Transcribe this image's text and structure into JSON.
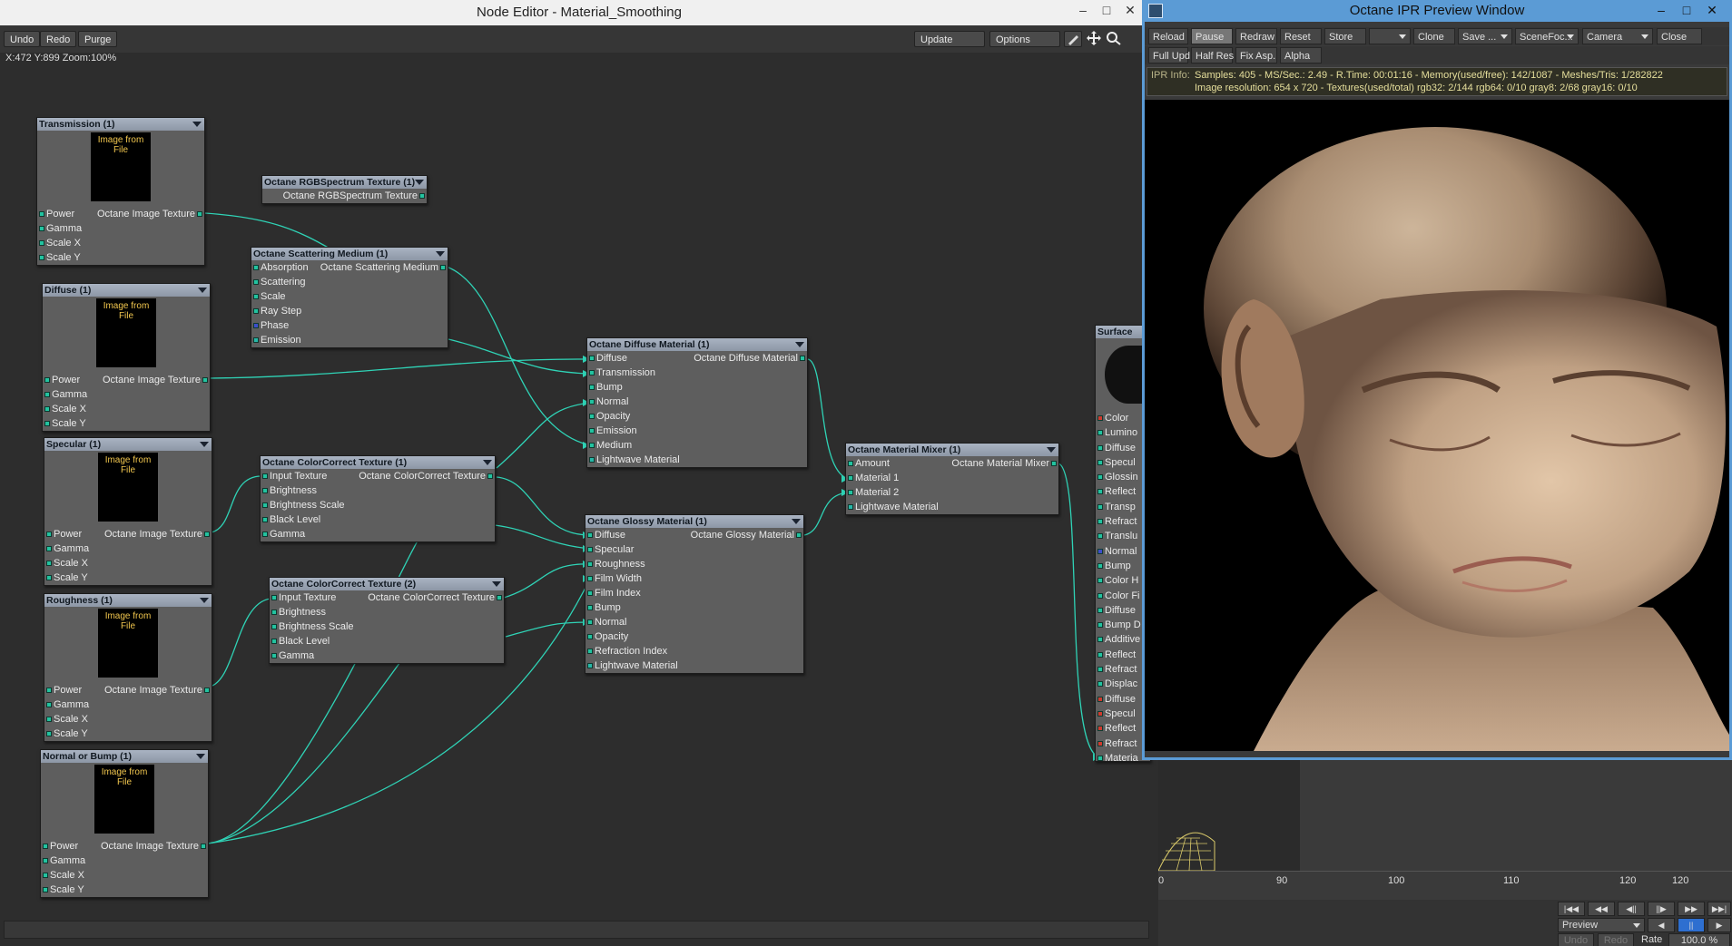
{
  "node_editor": {
    "title": "Node Editor - Material_Smoothing",
    "window_controls": [
      "_",
      "□",
      "✕"
    ],
    "toolbar": {
      "undo": "Undo",
      "redo": "Redo",
      "purge": "Purge",
      "update": "Update",
      "options": "Options"
    },
    "coords": "X:472 Y:899 Zoom:100%"
  },
  "nodes": {
    "transmission": {
      "title": "Transmission (1)",
      "preview": "Image from File",
      "out": "Octane Image Texture",
      "inputs": [
        "Power",
        "Gamma",
        "Scale X",
        "Scale Y"
      ]
    },
    "diffuse": {
      "title": "Diffuse (1)",
      "preview": "Image from File",
      "out": "Octane Image Texture",
      "inputs": [
        "Power",
        "Gamma",
        "Scale X",
        "Scale Y"
      ]
    },
    "specular": {
      "title": "Specular (1)",
      "preview": "Image from File",
      "out": "Octane Image Texture",
      "inputs": [
        "Power",
        "Gamma",
        "Scale X",
        "Scale Y"
      ]
    },
    "roughness": {
      "title": "Roughness (1)",
      "preview": "Image from File",
      "out": "Octane Image Texture",
      "inputs": [
        "Power",
        "Gamma",
        "Scale X",
        "Scale Y"
      ]
    },
    "normal_bump": {
      "title": "Normal or Bump (1)",
      "preview": "Image from File",
      "out": "Octane Image Texture",
      "inputs": [
        "Power",
        "Gamma",
        "Scale X",
        "Scale Y"
      ]
    },
    "rgb_spectrum": {
      "title": "Octane RGBSpectrum Texture (1)",
      "out": "Octane RGBSpectrum Texture"
    },
    "scattering": {
      "title": "Octane Scattering Medium (1)",
      "out": "Octane Scattering Medium",
      "inputs": [
        "Absorption",
        "Scattering",
        "Scale",
        "Ray Step",
        "Phase",
        "Emission"
      ]
    },
    "cc1": {
      "title": "Octane ColorCorrect Texture (1)",
      "out": "Octane ColorCorrect Texture",
      "inputs": [
        "Input Texture",
        "Brightness",
        "Brightness Scale",
        "Black Level",
        "Gamma"
      ]
    },
    "cc2": {
      "title": "Octane ColorCorrect Texture (2)",
      "out": "Octane ColorCorrect Texture",
      "inputs": [
        "Input Texture",
        "Brightness",
        "Brightness Scale",
        "Black Level",
        "Gamma"
      ]
    },
    "diffuse_mat": {
      "title": "Octane Diffuse Material (1)",
      "out": "Octane Diffuse Material",
      "inputs": [
        "Diffuse",
        "Transmission",
        "Bump",
        "Normal",
        "Opacity",
        "Emission",
        "Medium",
        "Lightwave Material"
      ]
    },
    "glossy_mat": {
      "title": "Octane Glossy Material (1)",
      "out": "Octane Glossy Material",
      "inputs": [
        "Diffuse",
        "Specular",
        "Roughness",
        "Film Width",
        "Film Index",
        "Bump",
        "Normal",
        "Opacity",
        "Refraction Index",
        "Lightwave Material"
      ]
    },
    "mixer": {
      "title": "Octane Material Mixer (1)",
      "out": "Octane Material Mixer",
      "inputs": [
        "Amount",
        "Material 1",
        "Material 2",
        "Lightwave Material"
      ]
    },
    "surface": {
      "title": "Surface",
      "inputs": [
        "Color",
        "Lumino",
        "Diffuse",
        "Specul",
        "Glossin",
        "Reflect",
        "Transp",
        "Refract",
        "Translu",
        "Normal",
        "Bump",
        "Color H",
        "Color Fi",
        "Diffuse",
        "Bump D",
        "Additive",
        "Reflect",
        "Refract",
        "Displac",
        "Diffuse",
        "Specul",
        "Reflect",
        "Refract",
        "Materia"
      ]
    }
  },
  "ipr": {
    "title": "Octane IPR Preview Window",
    "toolbar1": [
      "Reload",
      "Pause",
      "Redraw",
      "Reset",
      "Store",
      "",
      "Clone",
      "Save ...",
      "SceneFoc...",
      "Camera",
      "Close"
    ],
    "toolbar2": [
      "Full Upd.",
      "Half Res",
      "Fix Asp.",
      "Alpha"
    ],
    "info_label": "IPR Info:",
    "info_line1": "Samples: 405  -  MS/Sec.: 2.49  -  R.Time: 00:01:16 - Memory(used/free): 142/1087  -  Meshes/Tris: 1/282822",
    "info_line2": "Image resolution: 654 x 720 - Textures(used/total) rgb32: 2/144   rgb64: 0/10   gray8: 2/68   gray16: 0/10"
  },
  "timeline": {
    "ticks": [
      "0",
      "90",
      "100",
      "110",
      "120",
      "120"
    ],
    "preview_label": "Preview",
    "rate_label": "Rate",
    "rate_value": "100.0 %",
    "undo": "Undo",
    "redo": "Redo"
  },
  "colors": {
    "wire": "#2fd3b6",
    "accent": "#5b9bd5",
    "node_bg": "#5e5e5e",
    "header": "#9aa4b3"
  }
}
